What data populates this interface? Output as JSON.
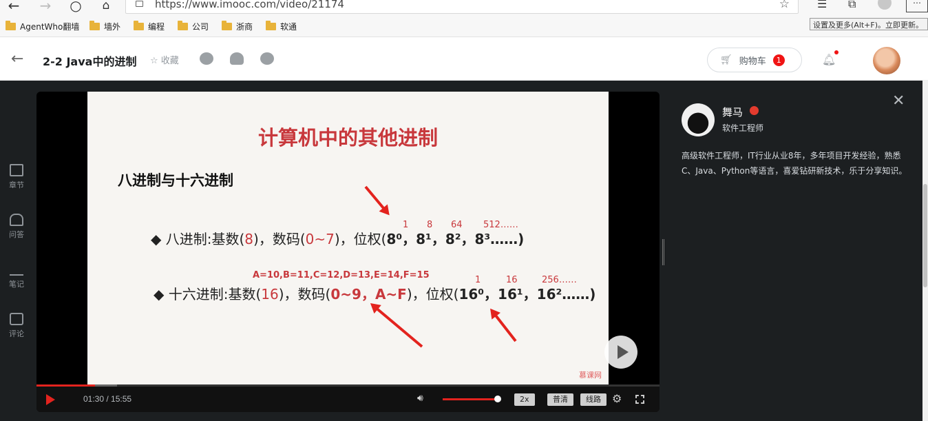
{
  "browser": {
    "url": "https://www.imooc.com/video/21174",
    "tooltip": "设置及更多(Alt+F)。立即更新。",
    "bookmarks": [
      "AgentWho翻墙",
      "墙外",
      "编程",
      "公司",
      "浙商",
      "软通"
    ]
  },
  "header": {
    "lesson_title": "2-2 Java中的进制",
    "favorite_label": "收藏",
    "cart_label": "购物车",
    "cart_count": "1"
  },
  "sidebar": {
    "items": [
      {
        "label": "章节",
        "icon": "chapters-icon"
      },
      {
        "label": "问答",
        "icon": "qa-icon"
      },
      {
        "label": "笔记",
        "icon": "notes-icon"
      },
      {
        "label": "评论",
        "icon": "comments-icon"
      }
    ]
  },
  "slide": {
    "title": "计算机中的其他进制",
    "subtitle": "八进制与十六进制",
    "octal_line": {
      "bullet": "◆",
      "prefix": "八进制:基数(",
      "base": "8",
      "mid1": ")，数码(",
      "digits": "0~7",
      "mid2": ")，位权(",
      "weights": "8⁰，8¹，8²，8³……)",
      "annot": [
        "1",
        "8",
        "64",
        "512……"
      ]
    },
    "hex_annot": "A=10,B=11,C=12,D=13,E=14,F=15",
    "hex_line": {
      "bullet": "◆",
      "prefix": "十六进制:基数(",
      "base": "16",
      "mid1": ")，数码(",
      "digits": "0~9，A~F",
      "mid2": ")，位权(",
      "weights": "16⁰，16¹，16²……)",
      "annot": [
        "1",
        "16",
        "256……"
      ]
    },
    "watermark": "慕课网"
  },
  "player": {
    "current_time": "01:30",
    "duration": "15:55",
    "time_display": "01:30 / 15:55",
    "progress": 0.094,
    "volume": 1.0,
    "speed_label": "2x",
    "quality_label": "普清",
    "route_label": "线路"
  },
  "teacher": {
    "name": "舞马",
    "role": "软件工程师",
    "bio": "高级软件工程师，IT行业从业8年，多年项目开发经验，熟悉C、Java、Python等语言，喜爱钻研新技术，乐于分享知识。"
  },
  "colors": {
    "accent": "#e3231e",
    "stage_bg": "#1c1f21",
    "slide_red": "#c8383c"
  }
}
